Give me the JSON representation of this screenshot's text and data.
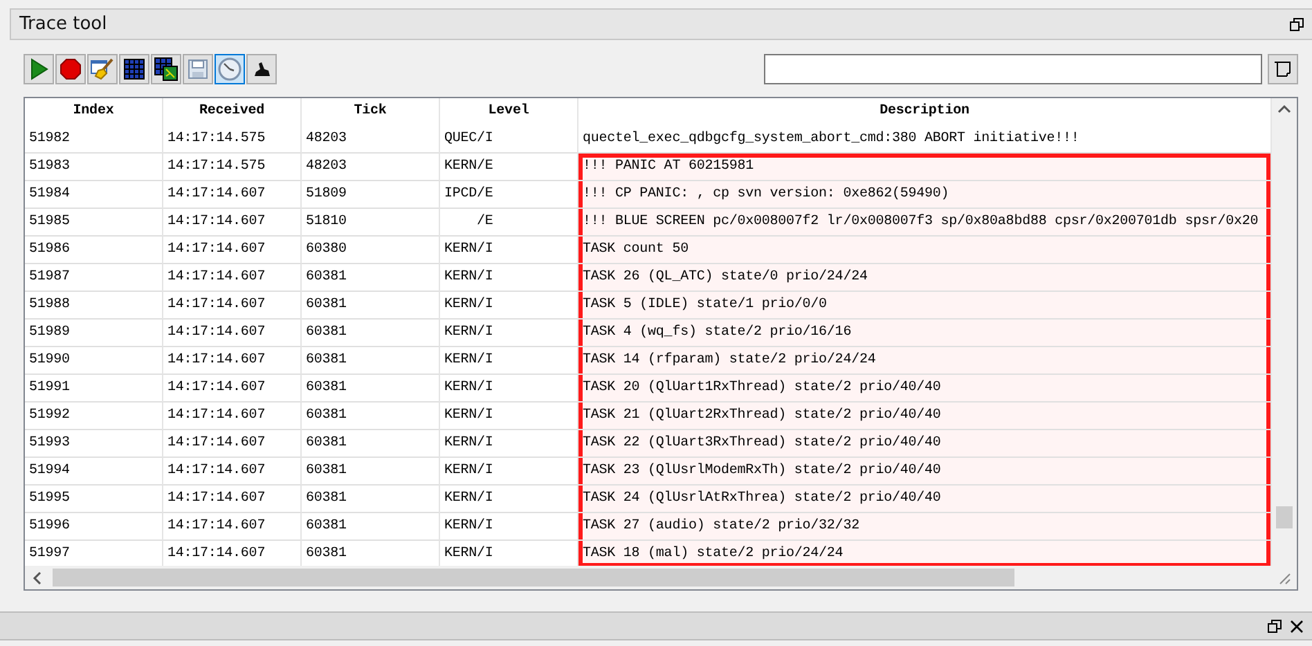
{
  "panel": {
    "title": "Trace tool"
  },
  "toolbar": [
    {
      "kind": "play",
      "selected": false
    },
    {
      "kind": "stop",
      "selected": false
    },
    {
      "kind": "clear",
      "selected": false
    },
    {
      "kind": "grid",
      "selected": false
    },
    {
      "kind": "map",
      "selected": false
    },
    {
      "kind": "save",
      "selected": false
    },
    {
      "kind": "clock",
      "selected": true
    },
    {
      "kind": "hand",
      "selected": false
    }
  ],
  "table": {
    "columns": [
      "Index",
      "Received",
      "Tick",
      "Level",
      "Description"
    ],
    "rows": [
      {
        "cells": [
          "51982",
          "14:17:14.575",
          "48203",
          "QUEC/I",
          "quectel_exec_qdbgcfg_system_abort_cmd:380 ABORT initiative!!!"
        ],
        "highlighted": false
      },
      {
        "cells": [
          "51983",
          "14:17:14.575",
          "48203",
          "KERN/E",
          "!!! PANIC AT 60215981"
        ],
        "highlighted": true
      },
      {
        "cells": [
          "51984",
          "14:17:14.607",
          "51809",
          "IPCD/E",
          "!!! CP PANIC: , cp svn version: 0xe862(59490)"
        ],
        "highlighted": true
      },
      {
        "cells": [
          "51985",
          "14:17:14.607",
          "51810",
          "    /E",
          "!!! BLUE SCREEN pc/0x008007f2 lr/0x008007f3 sp/0x80a8bd88 cpsr/0x200701db spsr/0x20"
        ],
        "highlighted": true
      },
      {
        "cells": [
          "51986",
          "14:17:14.607",
          "60380",
          "KERN/I",
          "TASK count 50"
        ],
        "highlighted": true
      },
      {
        "cells": [
          "51987",
          "14:17:14.607",
          "60381",
          "KERN/I",
          "TASK 26 (QL_ATC) state/0 prio/24/24"
        ],
        "highlighted": true
      },
      {
        "cells": [
          "51988",
          "14:17:14.607",
          "60381",
          "KERN/I",
          "TASK 5 (IDLE) state/1 prio/0/0"
        ],
        "highlighted": true
      },
      {
        "cells": [
          "51989",
          "14:17:14.607",
          "60381",
          "KERN/I",
          "TASK 4 (wq_fs) state/2 prio/16/16"
        ],
        "highlighted": true
      },
      {
        "cells": [
          "51990",
          "14:17:14.607",
          "60381",
          "KERN/I",
          "TASK 14 (rfparam) state/2 prio/24/24"
        ],
        "highlighted": true
      },
      {
        "cells": [
          "51991",
          "14:17:14.607",
          "60381",
          "KERN/I",
          "TASK 20 (QlUart1RxThread) state/2 prio/40/40"
        ],
        "highlighted": true
      },
      {
        "cells": [
          "51992",
          "14:17:14.607",
          "60381",
          "KERN/I",
          "TASK 21 (QlUart2RxThread) state/2 prio/40/40"
        ],
        "highlighted": true
      },
      {
        "cells": [
          "51993",
          "14:17:14.607",
          "60381",
          "KERN/I",
          "TASK 22 (QlUart3RxThread) state/2 prio/40/40"
        ],
        "highlighted": true
      },
      {
        "cells": [
          "51994",
          "14:17:14.607",
          "60381",
          "KERN/I",
          "TASK 23 (QlUsrlModemRxTh) state/2 prio/40/40"
        ],
        "highlighted": true
      },
      {
        "cells": [
          "51995",
          "14:17:14.607",
          "60381",
          "KERN/I",
          "TASK 24 (QlUsrlAtRxThrea) state/2 prio/40/40"
        ],
        "highlighted": true
      },
      {
        "cells": [
          "51996",
          "14:17:14.607",
          "60381",
          "KERN/I",
          "TASK 27 (audio) state/2 prio/32/32"
        ],
        "highlighted": true
      },
      {
        "cells": [
          "51997",
          "14:17:14.607",
          "60381",
          "KERN/I",
          "TASK 18 (mal) state/2 prio/24/24"
        ],
        "highlighted": true
      }
    ]
  }
}
